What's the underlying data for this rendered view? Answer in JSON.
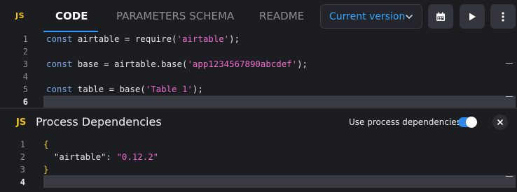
{
  "header": {
    "logo": "JS",
    "tabs": [
      {
        "label": "CODE",
        "active": true
      },
      {
        "label": "PARAMETERS SCHEMA",
        "active": false
      },
      {
        "label": "README",
        "active": false
      }
    ],
    "version_select": {
      "value": "Current version"
    },
    "icons": [
      "calendar-icon",
      "play-icon",
      "more-vertical-icon"
    ]
  },
  "editor": {
    "line_numbers": [
      "1",
      "2",
      "3",
      "4",
      "5",
      "6"
    ],
    "current_line": "6",
    "lines": [
      [
        {
          "t": "const",
          "c": "kw"
        },
        {
          "t": " airtable = require(",
          "c": ""
        },
        {
          "t": "'airtable'",
          "c": "str"
        },
        {
          "t": ");",
          "c": ""
        }
      ],
      [],
      [
        {
          "t": "const",
          "c": "kw"
        },
        {
          "t": " base = airtable.base(",
          "c": ""
        },
        {
          "t": "'app1234567890abcdef'",
          "c": "str"
        },
        {
          "t": ");",
          "c": ""
        }
      ],
      [],
      [
        {
          "t": "const",
          "c": "kw"
        },
        {
          "t": " table = base(",
          "c": ""
        },
        {
          "t": "'Table 1'",
          "c": "str"
        },
        {
          "t": ");",
          "c": ""
        }
      ],
      []
    ]
  },
  "dependencies_panel": {
    "logo": "JS",
    "title": "Process Dependencies",
    "toggle_label": "Use process dependencies",
    "toggle_on": true,
    "line_numbers": [
      "1",
      "2",
      "3",
      "4"
    ],
    "current_line": "4",
    "lines": [
      [
        {
          "t": "{",
          "c": "brace"
        }
      ],
      [
        {
          "t": "  \"airtable\": ",
          "c": "key"
        },
        {
          "t": "\"0.12.2\"",
          "c": "str"
        }
      ],
      [
        {
          "t": "}",
          "c": "brace"
        }
      ],
      []
    ]
  },
  "colors": {
    "background": "#1c1d21",
    "accent": "#2d9cff",
    "keyword": "#77a8e6",
    "string": "#f06bd0",
    "brace": "#f5d028",
    "js_badge": "#f5c518"
  }
}
